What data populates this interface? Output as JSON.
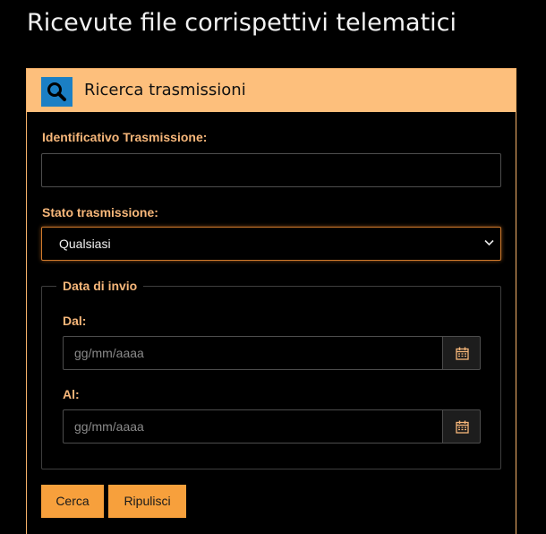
{
  "page": {
    "title": "Ricevute file corrispettivi telematici"
  },
  "panel": {
    "title": "Ricerca trasmissioni",
    "header_color": "#fdbf7c",
    "icon": "search-icon",
    "icon_bg_color": "#1b7fc4"
  },
  "form": {
    "id_label": "Identificativo Trasmissione:",
    "id_value": "",
    "status_label": "Stato trasmissione:",
    "status_selected": "Qualsiasi",
    "date_legend": "Data di invio",
    "from_label": "Dal:",
    "from_placeholder": "gg/mm/aaaa",
    "to_label": "Al:",
    "to_placeholder": "gg/mm/aaaa",
    "calendar_icon": "calendar-icon"
  },
  "buttons": {
    "search_label": "Cerca",
    "reset_label": "Ripulisci",
    "color": "#f7a03c"
  },
  "colors": {
    "accent": "#f7b77a",
    "background": "#000000"
  }
}
